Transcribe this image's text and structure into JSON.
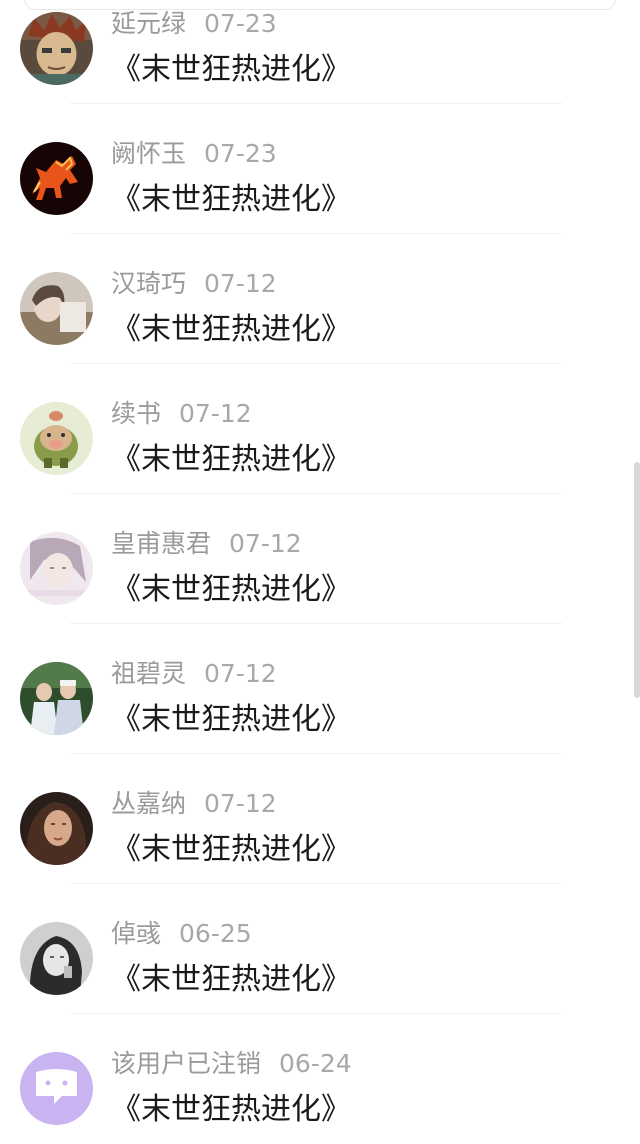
{
  "comments": [
    {
      "user": "延元绿",
      "date": "07-23",
      "message": "《末世狂热进化》",
      "avatar_icon": "anime-character-avatar"
    },
    {
      "user": "阙怀玉",
      "date": "07-23",
      "message": "《末世狂热进化》",
      "avatar_icon": "fire-horse-avatar"
    },
    {
      "user": "汉琦巧",
      "date": "07-12",
      "message": "《末世狂热进化》",
      "avatar_icon": "girl-photo-avatar"
    },
    {
      "user": "续书",
      "date": "07-12",
      "message": "《末世狂热进化》",
      "avatar_icon": "cartoon-pig-avatar"
    },
    {
      "user": "皇甫惠君",
      "date": "07-12",
      "message": "《末世狂热进化》",
      "avatar_icon": "pale-girl-avatar"
    },
    {
      "user": "祖碧灵",
      "date": "07-12",
      "message": "《末世狂热进化》",
      "avatar_icon": "girls-photo-avatar"
    },
    {
      "user": "丛嘉纳",
      "date": "07-12",
      "message": "《末世狂热进化》",
      "avatar_icon": "woman-portrait-avatar"
    },
    {
      "user": "倬彧",
      "date": "06-25",
      "message": "《末世狂热进化》",
      "avatar_icon": "bw-woman-avatar"
    },
    {
      "user": "该用户已注销",
      "date": "06-24",
      "message": "《末世狂热进化》",
      "avatar_icon": "deactivated-user-avatar"
    }
  ],
  "colors": {
    "username": "#9a9a9a",
    "date": "#a8a8a8",
    "message": "#1a1a1a",
    "divider": "#f0f0f0",
    "deactivated_avatar": "#c9b3f0"
  }
}
